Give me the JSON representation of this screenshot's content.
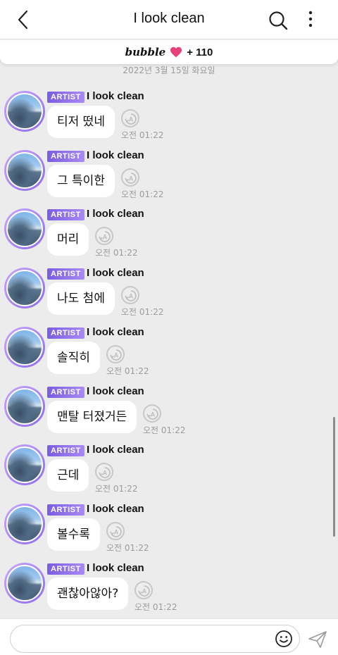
{
  "header": {
    "title": "I look clean",
    "icons": {
      "back": "chevron-left-icon",
      "search": "search-icon",
      "more": "more-vertical-icon"
    }
  },
  "bubble_bar": {
    "logo": "bubble",
    "heart_color": "#e8407a",
    "count": "+ 110"
  },
  "date_label": "2022년 3월 15일 화요일",
  "messages": [
    {
      "badge": "ARTIST",
      "sender": "I look clean",
      "text": "티저 떴네",
      "time": "오전 01:22"
    },
    {
      "badge": "ARTIST",
      "sender": "I look clean",
      "text": "그 특이한",
      "time": "오전 01:22"
    },
    {
      "badge": "ARTIST",
      "sender": "I look clean",
      "text": "머리",
      "time": "오전 01:22"
    },
    {
      "badge": "ARTIST",
      "sender": "I look clean",
      "text": "나도 첨에",
      "time": "오전 01:22"
    },
    {
      "badge": "ARTIST",
      "sender": "I look clean",
      "text": "솔직히",
      "time": "오전 01:22"
    },
    {
      "badge": "ARTIST",
      "sender": "I look clean",
      "text": "맨탈 터졌거든",
      "time": "오전 01:22"
    },
    {
      "badge": "ARTIST",
      "sender": "I look clean",
      "text": "근데",
      "time": "오전 01:22"
    },
    {
      "badge": "ARTIST",
      "sender": "I look clean",
      "text": "볼수록",
      "time": "오전 01:22"
    },
    {
      "badge": "ARTIST",
      "sender": "I look clean",
      "text": "괜찮아않아?",
      "time": "오전 01:22"
    }
  ],
  "input": {
    "value": "",
    "placeholder": ""
  },
  "colors": {
    "badge_start": "#7a5ce0",
    "badge_end": "#a98af4",
    "background": "#ececec"
  }
}
